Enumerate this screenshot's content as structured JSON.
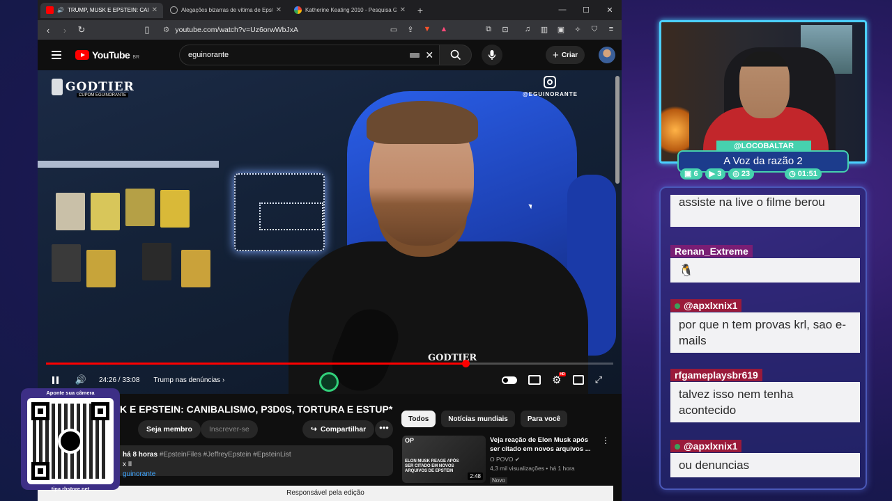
{
  "browser": {
    "tabs": [
      {
        "label": "TRUMP, MUSK E EPSTEIN: CANI",
        "active": true
      },
      {
        "label": "Alegações bizarras de vítima de Epstein - Gr",
        "active": false
      },
      {
        "label": "Katherine Keating 2010 - Pesquisa Google",
        "active": false
      }
    ],
    "url": "youtube.com/watch?v=Uz6orwWbJxA",
    "brave_badge": "99+"
  },
  "youtube": {
    "logo_text": "YouTube",
    "region": "BR",
    "search_query": "eguinorante",
    "create_label": "Criar",
    "video_overlay": {
      "channel_brand": "GODTIER",
      "brand_sub": "CUPOM EGUINORANTE",
      "instagram": "@EGUINORANTE",
      "shirt_text": "GODTIER"
    },
    "player": {
      "time": "24:26 / 33:08",
      "chapter": "Trump nas denúncias",
      "progress_fraction": 0.74,
      "settings_badge": "HD"
    },
    "title": "K E EPSTEIN: CANIBALISMO, P3D0S, TORTURA E ESTUP*",
    "buttons": {
      "member": "Seja membro",
      "subscribe": "Inscrever-se",
      "share": "Compartilhar"
    },
    "description": {
      "time": "há 8 horas",
      "tags": "#EpsteinFiles #JeffreyEpstein #EpsteinList",
      "line2": "x II",
      "link": "guinorante"
    },
    "chips": [
      "Todos",
      "Notícias mundiais",
      "Para você"
    ],
    "recommendation": {
      "thumb_tag": "OP",
      "thumb_text": "ELON MUSK REAGE APÓS SER CITADO EM NOVOS ARQUIVOS DE EPSTEIN",
      "duration": "2:48",
      "title": "Veja reação de Elon Musk após ser citado em novos arquivos ...",
      "channel": "O POVO",
      "stats": "4,3 mil visualizações • há 1 hora",
      "badge": "Novo"
    },
    "footer": "Responsável pela edição"
  },
  "qr": {
    "caption": "Aponte sua câmera",
    "url": "tipa.rbstore.net"
  },
  "stream": {
    "username": "@LOCOBALTAR",
    "title": "A Voz da razão 2",
    "stats": [
      "6",
      "3",
      "23",
      "01:51"
    ]
  },
  "chat": [
    {
      "user": "",
      "text": "assiste na live o filme berou"
    },
    {
      "user": "Renan_Extreme",
      "text": "🐧"
    },
    {
      "user": "@apxlxnix1",
      "text": "por que n tem provas krl, sao e-mails"
    },
    {
      "user": "rfgameplaysbr619",
      "text": "talvez isso nem tenha acontecido"
    },
    {
      "user": "@apxlxnix1",
      "text": "ou denuncias"
    }
  ]
}
